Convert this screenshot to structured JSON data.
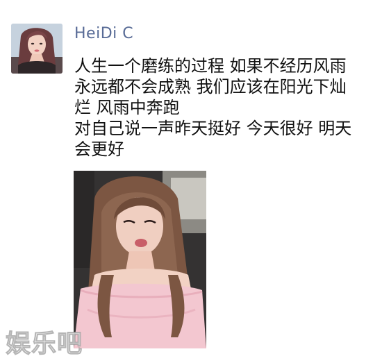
{
  "post": {
    "username": "HeiDi C",
    "text_lines": [
      "人生一个磨练的过程  如果不经历风雨",
      "永远都不会成熟  我们应该在阳光下灿",
      "烂  风雨中奔跑",
      "对自己说一声昨天挺好  今天很好  明天",
      "会更好"
    ]
  },
  "watermark": {
    "logo_text": "娱乐吧"
  },
  "colors": {
    "username": "#586b96",
    "text": "#111111",
    "background": "#ffffff"
  }
}
